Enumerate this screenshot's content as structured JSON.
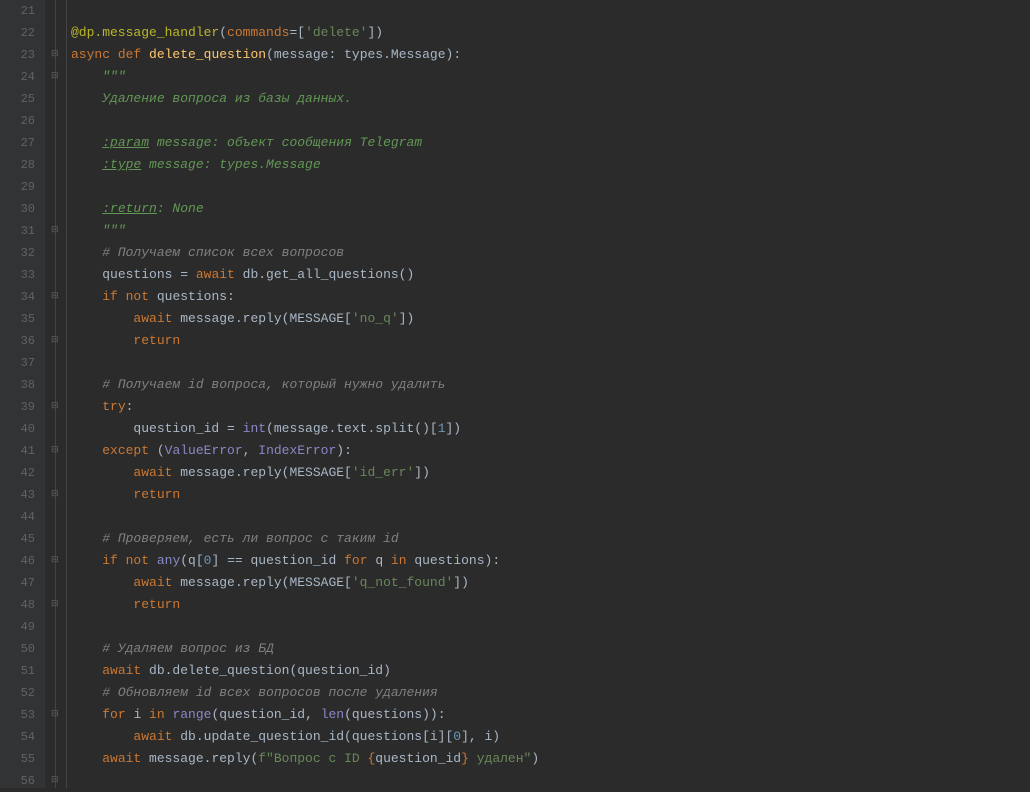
{
  "lines": {
    "start": 21,
    "end": 56
  },
  "code": {
    "l21": "",
    "l22_decorator": "@dp.message_handler",
    "l22_kw": "commands",
    "l22_str": "'delete'",
    "l23_async": "async ",
    "l23_def": "def ",
    "l23_fn": "delete_question",
    "l23_param": "message: types.Message",
    "l24_docopen": "\"\"\"",
    "l25_doc": "Удаление вопроса из базы данных.",
    "l27_tag": ":param",
    "l27_rest": " message: объект сообщения Telegram",
    "l28_tag": ":type",
    "l28_rest": " message: types.Message",
    "l30_tag": ":return",
    "l30_rest": ": None",
    "l31_docclose": "\"\"\"",
    "l32_comment": "# Получаем список всех вопросов",
    "l33_lhs": "questions = ",
    "l33_await": "await ",
    "l33_call": "db.get_all_questions()",
    "l34_if": "if ",
    "l34_not": "not ",
    "l34_rest": "questions:",
    "l35_await": "await ",
    "l35_call1": "message.reply(MESSAGE[",
    "l35_str": "'no_q'",
    "l35_call2": "])",
    "l36_return": "return",
    "l38_comment": "# Получаем id вопроса, который нужно удалить",
    "l39_try": "try",
    "l40_lhs": "question_id = ",
    "l40_int": "int",
    "l40_mid": "(message.text.split()[",
    "l40_num": "1",
    "l40_end": "])",
    "l41_except": "except ",
    "l41_err1": "ValueError",
    "l41_err2": "IndexError",
    "l42_await": "await ",
    "l42_call1": "message.reply(MESSAGE[",
    "l42_str": "'id_err'",
    "l42_call2": "])",
    "l43_return": "return",
    "l45_comment": "# Проверяем, есть ли вопрос с таким id",
    "l46_if": "if ",
    "l46_not": "not ",
    "l46_any": "any",
    "l46_a": "(q[",
    "l46_zero": "0",
    "l46_b": "] == question_id ",
    "l46_for": "for ",
    "l46_q": "q ",
    "l46_in": "in ",
    "l46_c": "questions):",
    "l47_await": "await ",
    "l47_call1": "message.reply(MESSAGE[",
    "l47_str": "'q_not_found'",
    "l47_call2": "])",
    "l48_return": "return",
    "l50_comment": "# Удаляем вопрос из БД",
    "l51_await": "await ",
    "l51_call": "db.delete_question(question_id)",
    "l52_comment": "# Обновляем id всех вопросов после удаления",
    "l53_for": "for ",
    "l53_i": "i ",
    "l53_in": "in ",
    "l53_range": "range",
    "l53_a": "(question_id, ",
    "l53_len": "len",
    "l53_b": "(questions)):",
    "l54_await": "await ",
    "l54_call1": "db.update_question_id(questions[i][",
    "l54_zero": "0",
    "l54_call2": "], i)",
    "l55_await": "await ",
    "l55_call1": "message.reply(",
    "l55_fpre": "f\"Вопрос с ID ",
    "l55_lb": "{",
    "l55_var": "question_id",
    "l55_rb": "}",
    "l55_fpost": " удален\"",
    "l55_end": ")"
  }
}
